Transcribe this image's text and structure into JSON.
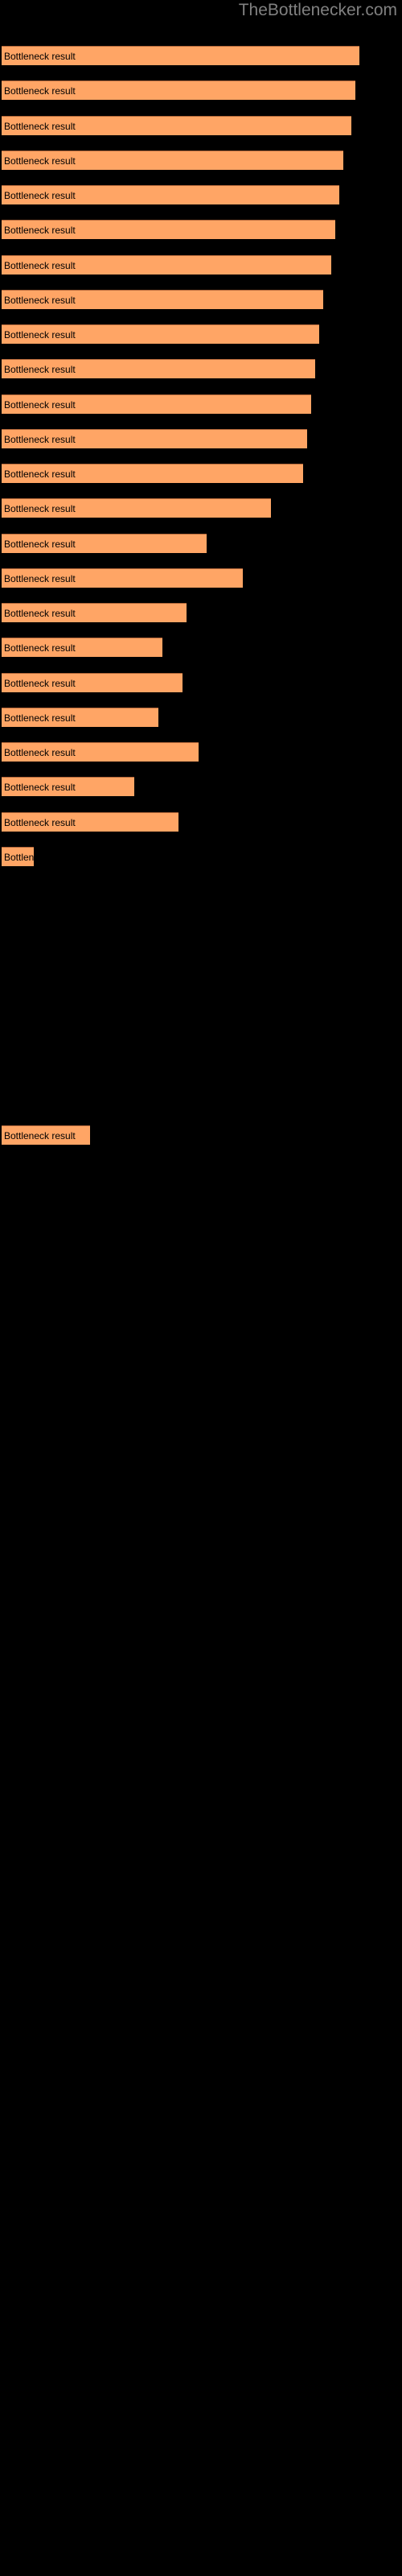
{
  "watermark": "TheBottlenecker.com",
  "background_color": "#000000",
  "bar_color": "#ffa565",
  "bar_edge_color": "#b2673a",
  "label_color": "#000000",
  "watermark_color": "#808080",
  "bar_label": "Bottleneck result",
  "chart_data": {
    "type": "bar",
    "orientation": "horizontal",
    "title": "TheBottlenecker.com",
    "xlabel": "",
    "ylabel": "",
    "grid": false,
    "legend": null,
    "bar_color": "#ffa565",
    "background": "#000000",
    "categories": [
      "Bottleneck result",
      "Bottleneck result",
      "Bottleneck result",
      "Bottleneck result",
      "Bottleneck result",
      "Bottleneck result",
      "Bottleneck result",
      "Bottleneck result",
      "Bottleneck result",
      "Bottleneck result",
      "Bottleneck result",
      "Bottleneck result",
      "Bottleneck result",
      "Bottleneck result",
      "Bottleneck result",
      "Bottleneck result",
      "Bottleneck result",
      "Bottleneck result",
      "Bottleneck result",
      "Bottleneck result",
      "Bottleneck result",
      "Bottleneck result",
      "Bottleneck result",
      "Bottleneck result",
      "Bottleneck result",
      "Bottleneck result",
      "Bottleneck result",
      "Bottleneck result",
      "Bottleneck result",
      "Bottleneck result",
      "Bottleneck result",
      "Bottleneck result",
      "Bottleneck result",
      "Bottleneck result",
      "Bottleneck result",
      "Bottleneck result"
    ],
    "values": [
      89,
      88,
      87,
      85,
      84,
      83,
      82,
      80,
      79,
      78,
      77,
      76,
      75,
      67,
      51,
      60,
      46,
      40,
      45,
      39,
      49,
      33,
      44,
      8,
      0,
      0,
      0,
      0,
      0,
      0,
      0,
      22,
      0,
      0,
      0,
      0
    ],
    "xlim": [
      0,
      100
    ],
    "bar_top_positions": [
      57,
      100,
      144,
      187,
      230,
      273,
      317,
      360,
      403,
      446,
      490,
      533,
      576,
      619,
      663,
      706,
      749,
      792,
      836,
      879,
      922,
      965,
      1009,
      1052,
      1095,
      1138,
      1182,
      1225,
      1268,
      1311,
      1355,
      1398,
      1441,
      1484,
      1528,
      1571
    ]
  },
  "bars": [
    {
      "label": "Bottleneck result",
      "top": 57,
      "width": 89
    },
    {
      "label": "Bottleneck result",
      "top": 100,
      "width": 88
    },
    {
      "label": "Bottleneck result",
      "top": 144,
      "width": 87
    },
    {
      "label": "Bottleneck result",
      "top": 187,
      "width": 85
    },
    {
      "label": "Bottleneck result",
      "top": 230,
      "width": 84
    },
    {
      "label": "Bottleneck result",
      "top": 273,
      "width": 83
    },
    {
      "label": "Bottleneck result",
      "top": 317,
      "width": 82
    },
    {
      "label": "Bottleneck result",
      "top": 360,
      "width": 80
    },
    {
      "label": "Bottleneck result",
      "top": 403,
      "width": 79
    },
    {
      "label": "Bottleneck result",
      "top": 446,
      "width": 78
    },
    {
      "label": "Bottleneck result",
      "top": 490,
      "width": 77
    },
    {
      "label": "Bottleneck result",
      "top": 533,
      "width": 76
    },
    {
      "label": "Bottleneck result",
      "top": 576,
      "width": 75
    },
    {
      "label": "Bottleneck result",
      "top": 619,
      "width": 67
    },
    {
      "label": "Bottleneck result",
      "top": 663,
      "width": 51
    },
    {
      "label": "Bottleneck result",
      "top": 706,
      "width": 60
    },
    {
      "label": "Bottleneck result",
      "top": 749,
      "width": 46
    },
    {
      "label": "Bottleneck result",
      "top": 792,
      "width": 40
    },
    {
      "label": "Bottleneck result",
      "top": 836,
      "width": 45
    },
    {
      "label": "Bottleneck result",
      "top": 879,
      "width": 39
    },
    {
      "label": "Bottleneck result",
      "top": 922,
      "width": 49
    },
    {
      "label": "Bottleneck result",
      "top": 965,
      "width": 33
    },
    {
      "label": "Bottleneck result",
      "top": 1009,
      "width": 44
    },
    {
      "label": "Bottleneck result",
      "top": 1052,
      "width": 8
    },
    {
      "label": "Bottleneck result",
      "top": 1095,
      "width": 0
    },
    {
      "label": "Bottleneck result",
      "top": 1138,
      "width": 0
    },
    {
      "label": "Bottleneck result",
      "top": 1182,
      "width": 0
    },
    {
      "label": "Bottleneck result",
      "top": 1225,
      "width": 0
    },
    {
      "label": "Bottleneck result",
      "top": 1268,
      "width": 0
    },
    {
      "label": "Bottleneck result",
      "top": 1311,
      "width": 0
    },
    {
      "label": "Bottleneck result",
      "top": 1355,
      "width": 0
    },
    {
      "label": "Bottleneck result",
      "top": 1398,
      "width": 22
    },
    {
      "label": "Bottleneck result",
      "top": 1441,
      "width": 0
    },
    {
      "label": "Bottleneck result",
      "top": 1484,
      "width": 0
    },
    {
      "label": "Bottleneck result",
      "top": 1528,
      "width": 0
    },
    {
      "label": "Bottleneck result",
      "top": 1571,
      "width": 0
    }
  ]
}
